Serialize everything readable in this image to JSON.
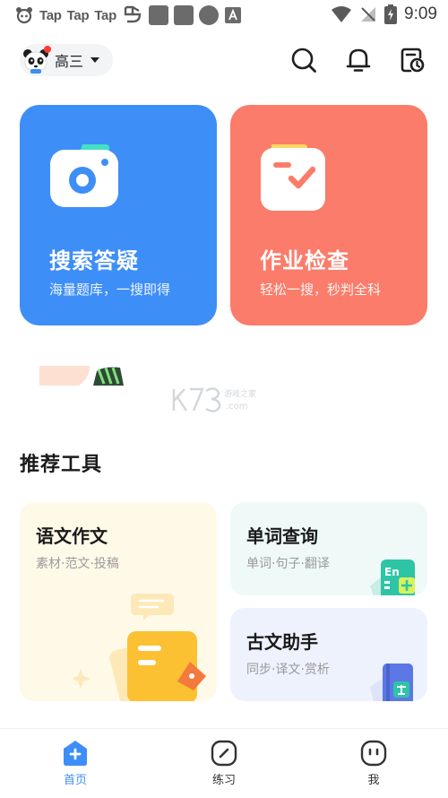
{
  "status_bar": {
    "tap_1": "Tap",
    "tap_2": "Tap",
    "tap_3": "Tap",
    "time": "9:09"
  },
  "header": {
    "grade": "高三"
  },
  "cards": [
    {
      "title": "搜索答疑",
      "subtitle": "海量题库，一搜即得",
      "color": "#3e8ef7"
    },
    {
      "title": "作业检查",
      "subtitle": "轻松一搜，秒判全科",
      "color": "#fb7c6a"
    }
  ],
  "section": {
    "title": "推荐工具"
  },
  "tools": [
    {
      "title": "语文作文",
      "subtitle": "素材·范文·投稿"
    },
    {
      "title": "单词查询",
      "subtitle": "单词·句子·翻译"
    },
    {
      "title": "古文助手",
      "subtitle": "同步·译文·赏析"
    }
  ],
  "bottom_nav": [
    {
      "label": "首页",
      "icon": "home-plus-icon",
      "active": true
    },
    {
      "label": "练习",
      "icon": "compass-icon",
      "active": false
    },
    {
      "label": "我",
      "icon": "face-icon",
      "active": false
    }
  ],
  "accent_color": "#3e8ef7"
}
